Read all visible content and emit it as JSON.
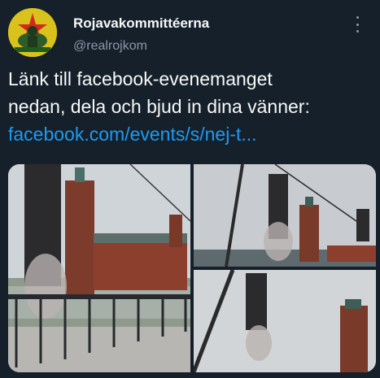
{
  "tweet": {
    "display_name": "Rojavakommittéerna",
    "handle": "@realrojkom",
    "text_line1": "Länk till facebook-evenemanget",
    "text_line2": "nedan, dela och bjud in dina vänner:",
    "link": "facebook.com/events/s/nej-t...",
    "more_icon": "more-icon",
    "avatar_icon": "avatar-flag-icon"
  },
  "colors": {
    "background": "#15202b",
    "text": "#f7f9f9",
    "secondary": "#8b98a5",
    "link": "#1d9bf0",
    "avatar_yellow": "#d9c21c",
    "avatar_red": "#d2281e"
  },
  "media": {
    "photo_count": 3
  }
}
